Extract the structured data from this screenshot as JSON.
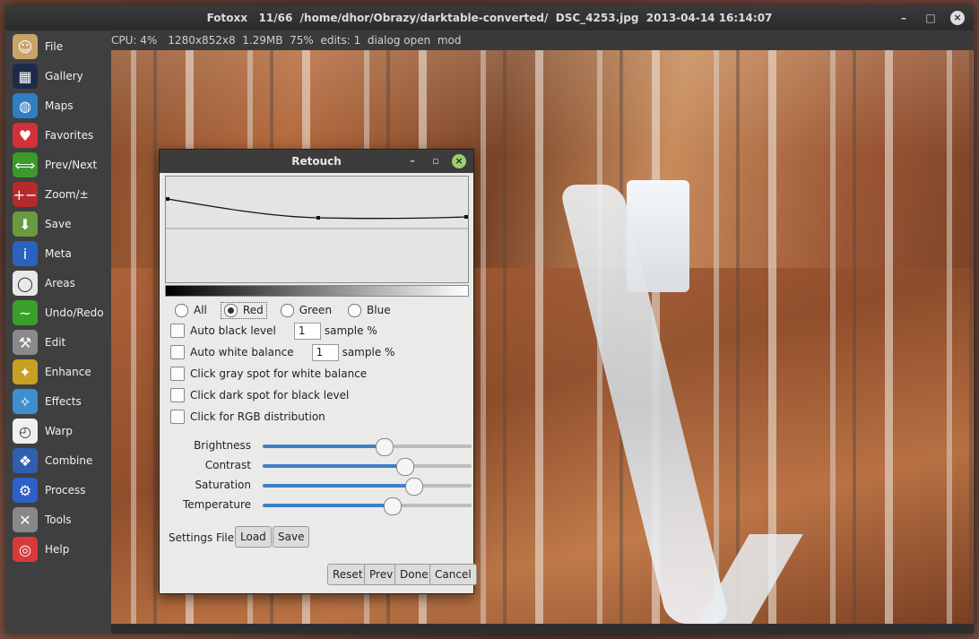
{
  "window": {
    "title": "Fotoxx   11/66  /home/dhor/Obrazy/darktable-converted/  DSC_4253.jpg  2013-04-14 16:14:07",
    "minimize": "–",
    "maximize": "□",
    "close": "×"
  },
  "status": {
    "cpu": "CPU: 4%",
    "info": "1280x852x8  1.29MB  75%  edits: 1  dialog open  mod"
  },
  "sidebar": {
    "items": [
      {
        "label": "File",
        "icon": "portrait-icon"
      },
      {
        "label": "Gallery",
        "icon": "gallery-grid-icon"
      },
      {
        "label": "Maps",
        "icon": "globe-icon"
      },
      {
        "label": "Favorites",
        "icon": "heart-icon"
      },
      {
        "label": "Prev/Next",
        "icon": "double-arrow-icon"
      },
      {
        "label": "Zoom/±",
        "icon": "zoom-icon"
      },
      {
        "label": "Save",
        "icon": "save-icon"
      },
      {
        "label": "Meta",
        "icon": "info-icon"
      },
      {
        "label": "Areas",
        "icon": "lasso-icon"
      },
      {
        "label": "Undo/Redo",
        "icon": "undo-redo-icon"
      },
      {
        "label": "Edit",
        "icon": "hammer-icon"
      },
      {
        "label": "Enhance",
        "icon": "magic-wand-icon"
      },
      {
        "label": "Effects",
        "icon": "effects-icon"
      },
      {
        "label": "Warp",
        "icon": "clock-icon"
      },
      {
        "label": "Combine",
        "icon": "combine-icon"
      },
      {
        "label": "Process",
        "icon": "gear-icon"
      },
      {
        "label": "Tools",
        "icon": "tools-icon"
      },
      {
        "label": "Help",
        "icon": "lifebuoy-icon"
      }
    ]
  },
  "dialog": {
    "title": "Retouch",
    "minimize": "–",
    "restore": "▫",
    "close": "×",
    "channels": [
      {
        "label": "All",
        "selected": false
      },
      {
        "label": "Red",
        "selected": true
      },
      {
        "label": "Green",
        "selected": false
      },
      {
        "label": "Blue",
        "selected": false
      }
    ],
    "auto_black": {
      "label": "Auto black level",
      "value": "1",
      "suffix": "sample %"
    },
    "auto_white": {
      "label": "Auto white balance",
      "value": "1",
      "suffix": "sample %"
    },
    "gray_spot": "Click gray spot for white balance",
    "dark_spot": "Click dark spot for black level",
    "rgb_dist": "Click for RGB distribution",
    "sliders": [
      {
        "label": "Brightness",
        "value": 0.58
      },
      {
        "label": "Contrast",
        "value": 0.68
      },
      {
        "label": "Saturation",
        "value": 0.72
      },
      {
        "label": "Temperature",
        "value": 0.62
      }
    ],
    "settings_label": "Settings File",
    "load": "Load",
    "save": "Save",
    "reset": "Reset",
    "prev": "Prev",
    "done": "Done",
    "cancel": "Cancel"
  }
}
